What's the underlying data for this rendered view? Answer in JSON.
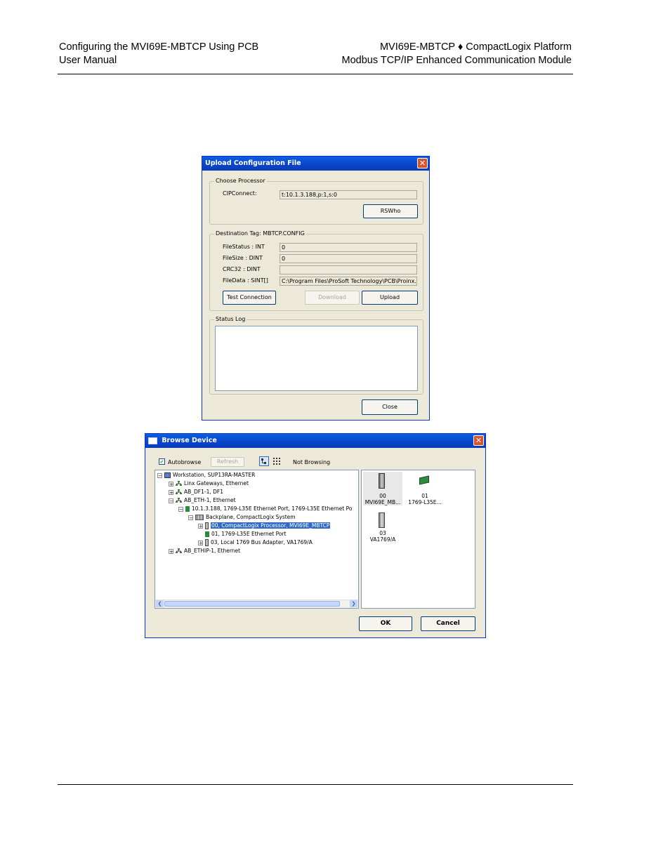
{
  "header": {
    "left_line1": "Configuring the MVI69E-MBTCP Using PCB",
    "left_line2": "User Manual",
    "right_line1": "MVI69E-MBTCP ♦ CompactLogix Platform",
    "right_line2": "Modbus TCP/IP Enhanced Communication Module"
  },
  "upload_dialog": {
    "title": "Upload Configuration File",
    "close_glyph": "✕",
    "choose_processor": {
      "group_title": "Choose Processor",
      "cipconnect_label": "CIPConnect:",
      "cipconnect_value": "t:10.1.3.188,p:1,s:0",
      "rswho_label": "RSWho"
    },
    "destination": {
      "group_title": "Destination Tag: MBTCP.CONFIG",
      "filestatus_label": "FileStatus : INT",
      "filestatus_value": "0",
      "filesize_label": "FileSize    : DINT",
      "filesize_value": "0",
      "crc32_label": "CRC32     : DINT",
      "crc32_value": "",
      "filedata_label": "FileData   : SINT[]",
      "filedata_value": "C:\\Program Files\\ProSoft Technology\\PCB\\Proinx.c",
      "test_connection_label": "Test Connection",
      "download_label": "Download",
      "upload_label": "Upload"
    },
    "status_log": {
      "group_title": "Status Log"
    },
    "close_label": "Close"
  },
  "browse_dialog": {
    "title": "Browse Device",
    "close_glyph": "✕",
    "autobrowse_label": "Autobrowse",
    "autobrowse_checked": "✔",
    "refresh_label": "Refresh",
    "status_text": "Not Browsing",
    "tree": [
      {
        "text": "Workstation, SUP13RA-MASTER",
        "expander": "−"
      },
      {
        "text": "Linx Gateways, Ethernet",
        "expander": "+"
      },
      {
        "text": "AB_DF1-1, DF1",
        "expander": "+"
      },
      {
        "text": "AB_ETH-1, Ethernet",
        "expander": "−"
      },
      {
        "text": "10.1.3.188, 1769-L35E Ethernet Port, 1769-L35E Ethernet Po",
        "expander": "−"
      },
      {
        "text": "Backplane, CompactLogix System",
        "expander": "−"
      },
      {
        "text": "00, CompactLogix Processor, MVI69E_MBTCP",
        "expander": "+"
      },
      {
        "text": "01, 1769-L35E Ethernet Port",
        "expander": ""
      },
      {
        "text": "03, Local 1769 Bus Adapter, VA1769/A",
        "expander": "+"
      },
      {
        "text": "AB_ETHIP-1, Ethernet",
        "expander": "+"
      }
    ],
    "devices": [
      {
        "slot": "00",
        "name": "MVI69E_MB..."
      },
      {
        "slot": "01",
        "name": "1769-L35E..."
      },
      {
        "slot": "03",
        "name": "VA1769/A"
      }
    ],
    "scroll_left": "❮",
    "scroll_right": "❯",
    "ok_label": "OK",
    "cancel_label": "Cancel"
  }
}
